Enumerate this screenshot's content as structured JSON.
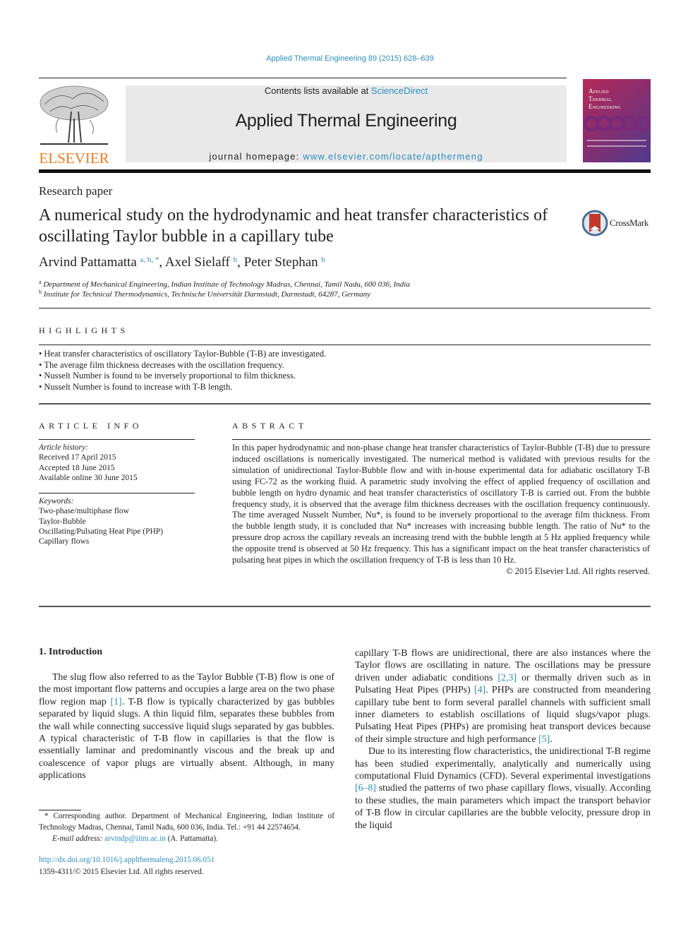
{
  "header": {
    "citation": "Applied Thermal Engineering 89 (2015) 628–639",
    "contents_prefix": "Contents lists available at ",
    "contents_link": "ScienceDirect",
    "journal_name": "Applied Thermal Engineering",
    "homepage_prefix": "journal homepage: ",
    "homepage_link": "www.elsevier.com/locate/apthermeng",
    "publisher_logo_text": "ELSEVIER",
    "cover_title_lines": [
      "Applied",
      "Thermal",
      "Engineering"
    ],
    "colors": {
      "link": "#2a8bbf",
      "elsevier_orange": "#f07c1b",
      "masthead_bg": "#e9e9e9"
    }
  },
  "article": {
    "type": "Research paper",
    "title": "A numerical study on the hydrodynamic and heat transfer characteristics of oscillating Taylor bubble in a capillary tube",
    "crossmark_label": "CrossMark",
    "authors": [
      {
        "name": "Arvind Pattamatta",
        "sup": "a, b, *",
        "sep": ", "
      },
      {
        "name": "Axel Sielaff",
        "sup": "b",
        "sep": ", "
      },
      {
        "name": "Peter Stephan",
        "sup": "b",
        "sep": ""
      }
    ],
    "affiliations": [
      {
        "mark": "a",
        "text": "Department of Mechanical Engineering, Indian Institute of Technology Madras, Chennai, Tamil Nadu, 600 036, India"
      },
      {
        "mark": "b",
        "text": "Institute for Technical Thermodynamics, Technische Universität Darmstadt, Darmstadt, 64287, Germany"
      }
    ]
  },
  "highlights": {
    "heading": "HIGHLIGHTS",
    "items": [
      "Heat transfer characteristics of oscillatory Taylor-Bubble (T-B) are investigated.",
      "The average film thickness decreases with the oscillation frequency.",
      "Nusselt Number is found to be inversely proportional to film thickness.",
      "Nusselt Number is found to increase with T-B length."
    ]
  },
  "article_info": {
    "heading": "ARTICLE INFO",
    "history_label": "Article history:",
    "history": [
      "Received 17 April 2015",
      "Accepted 18 June 2015",
      "Available online 30 June 2015"
    ],
    "keywords_label": "Keywords:",
    "keywords": [
      "Two-phase/multiphase flow",
      "Taylor-Bubble",
      "Oscillating/Pulsating Heat Pipe (PHP)",
      "Capillary flows"
    ]
  },
  "abstract": {
    "heading": "ABSTRACT",
    "text": "In this paper hydrodynamic and non-phase change heat transfer characteristics of Taylor-Bubble (T-B) due to pressure induced oscillations is numerically investigated. The numerical method is validated with previous results for the simulation of unidirectional Taylor-Bubble flow and with in-house experimental data for adiabatic oscillatory T-B using FC-72 as the working fluid. A parametric study involving the effect of applied frequency of oscillation and bubble length on hydro dynamic and heat transfer characteristics of oscillatory T-B is carried out. From the bubble frequency study, it is observed that the average film thickness decreases with the oscillation frequency continuously. The time averaged Nusselt Number, Nu*, is found to be inversely proportional to the average film thickness. From the bubble length study, it is concluded that Nu* increases with increasing bubble length. The ratio of Nu* to the pressure drop across the capillary reveals an increasing trend with the bubble length at 5 Hz applied frequency while the opposite trend is observed at 50 Hz frequency. This has a significant impact on the heat transfer characteristics of pulsating heat pipes in which the oscillation frequency of T-B is less than 10 Hz.",
    "copyright": "© 2015 Elsevier Ltd. All rights reserved."
  },
  "body": {
    "section_heading": "1.  Introduction",
    "left_col": {
      "p1_before_ref1": "The slug flow also referred to as the Taylor Bubble (T-B) flow is one of the most important flow patterns and occupies a large area on the two phase flow region map ",
      "ref1": "[1]",
      "p1_after_ref1": ". T-B flow is typically characterized by gas bubbles separated by liquid slugs. A thin liquid film, separates these bubbles from the wall while connecting successive liquid slugs separated by gas bubbles. A typical characteristic of T-B flow in capillaries is that the flow is essentially laminar and predominantly viscous and the break up and coalescence of vapor plugs are virtually absent. Although, in many applications"
    },
    "right_col": {
      "p1_a": "capillary T-B flows are unidirectional, there are also instances where the Taylor flows are oscillating in nature. The oscillations may be pressure driven under adiabatic conditions ",
      "ref23": "[2,3]",
      "p1_b": " or thermally driven such as in Pulsating Heat Pipes (PHPs) ",
      "ref4": "[4]",
      "p1_c": ". PHPs are constructed from meandering capillary tube bent to form several parallel channels with sufficient small inner diameters to establish oscillations of liquid slugs/vapor plugs. Pulsating Heat Pipes (PHPs) are promising heat transport devices because of their simple structure and high performance ",
      "ref5": "[5]",
      "p1_d": ".",
      "p2_a": "Due to its interesting flow characteristics, the unidirectional T-B regime has been studied experimentally, analytically and numerically using computational Fluid Dynamics (CFD). Several experimental investigations ",
      "ref68": "[6–8]",
      "p2_b": " studied the patterns of two phase capillary flows, visually. According to these studies, the main parameters which impact the transport behavior of T-B flow in circular capillaries are the bubble velocity, pressure drop in the liquid"
    }
  },
  "footnote": {
    "corresponding": "* Corresponding author. Department of Mechanical Engineering, Indian Institute of Technology Madras, Chennai, Tamil Nadu, 600 036, India. Tel.: +91 44 22574654.",
    "email_label": "E-mail address: ",
    "email": "arvindp@iitm.ac.in",
    "email_suffix": " (A. Pattamatta).",
    "doi": "http://dx.doi.org/10.1016/j.applthermaleng.2015.06.051",
    "issn": "1359-4311/© 2015 Elsevier Ltd. All rights reserved."
  }
}
